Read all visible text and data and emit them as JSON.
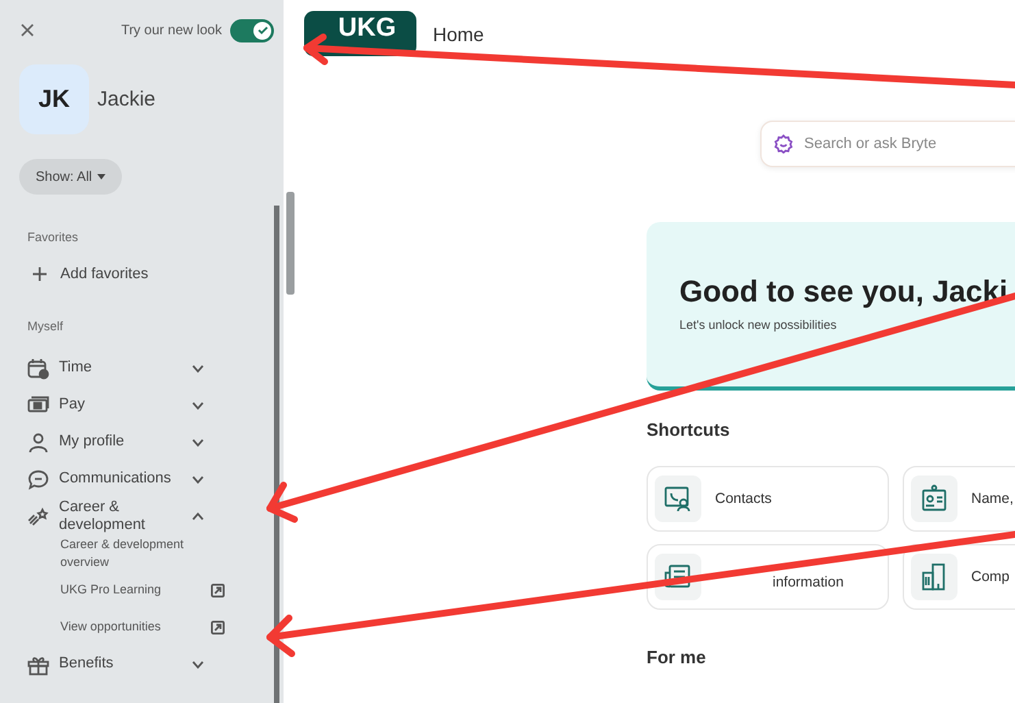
{
  "sidebar": {
    "toggle": {
      "label": "Try our new look",
      "on": true
    },
    "user": {
      "initials": "JK",
      "name": "Jackie"
    },
    "filter": "Show: All",
    "sections": [
      {
        "title": "Favorites",
        "items": [
          {
            "kind": "add",
            "label": "Add favorites"
          }
        ]
      },
      {
        "title": "Myself",
        "items": [
          {
            "kind": "nav",
            "label": "Time",
            "expanded": false
          },
          {
            "kind": "nav",
            "label": "Pay",
            "expanded": false
          },
          {
            "kind": "nav",
            "label": "My profile",
            "expanded": false
          },
          {
            "kind": "nav",
            "label": "Communications",
            "expanded": false
          },
          {
            "kind": "nav",
            "label": "Career & development",
            "expanded": true,
            "children": [
              {
                "label": "Career & development overview",
                "external": false
              },
              {
                "label": "UKG Pro Learning",
                "external": true
              },
              {
                "label": "View opportunities",
                "external": true
              }
            ]
          },
          {
            "kind": "nav",
            "label": "Benefits",
            "expanded": false
          }
        ]
      }
    ]
  },
  "header": {
    "logo": "UKG",
    "title": "Home"
  },
  "search": {
    "placeholder": "Search or ask Bryte"
  },
  "welcome": {
    "heading": "Good to see you, Jacki",
    "subtitle": "Let's unlock new possibilities"
  },
  "shortcuts": {
    "title": "Shortcuts",
    "items": [
      {
        "label": "Contacts"
      },
      {
        "label": "Name,"
      },
      {
        "label": "information"
      },
      {
        "label": "Comp"
      }
    ]
  },
  "for_me": {
    "title": "For me"
  }
}
